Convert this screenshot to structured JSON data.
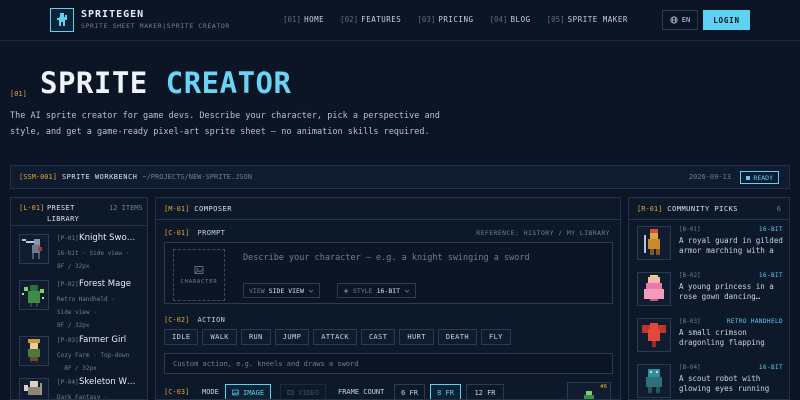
{
  "nav": {
    "brand": "SPRITEGEN",
    "subtitle": "SPRITE SHEET MAKER|SPRITE CREATOR",
    "links": [
      {
        "num": "[01]",
        "label": "HOME"
      },
      {
        "num": "[02]",
        "label": "FEATURES"
      },
      {
        "num": "[03]",
        "label": "PRICING"
      },
      {
        "num": "[04]",
        "label": "BLOG"
      },
      {
        "num": "[05]",
        "label": "SPRITE MAKER"
      }
    ],
    "lang": "EN",
    "login": "LOGIN"
  },
  "hero": {
    "tag": "[01]",
    "title_a": "SPRITE",
    "title_b": "CREATOR",
    "description": "The AI sprite creator for game devs. Describe your character, pick a perspective and style, and get a game-ready pixel-art sprite sheet — no animation skills required."
  },
  "workbench": {
    "tag": "[SSM-001]",
    "name": "SPRITE WORKBENCH",
    "path": "~/PROJECTS/NEW-SPRITE.JSON",
    "date": "2026-09-13",
    "status": "READY"
  },
  "library": {
    "tag": "[L-01]",
    "title": "PRESET LIBRARY",
    "count": "12 ITEMS",
    "items": [
      {
        "code": "[P-01]",
        "name": "Knight Swo…",
        "meta1": "16-bit · Side view ·",
        "meta2": "8F / 32px"
      },
      {
        "code": "[P-02]",
        "name": "Forest Mage",
        "meta1": "Retro Handheld ·",
        "meta2": "Side view ·",
        "meta3": "8F / 32px"
      },
      {
        "code": "[P-03]",
        "name": "Farmer Girl",
        "meta1": "Cozy Farm · Top-down",
        "meta2": "· 8F / 32px"
      },
      {
        "code": "[P-04]",
        "name": "Skeleton W…",
        "meta1": "Dark Fantasy ·"
      }
    ]
  },
  "composer": {
    "tag": "[M-01]",
    "title": "COMPOSER",
    "prompt_tag": "[C-01]",
    "prompt_title": "PROMPT",
    "reference": "REFERENCE: HISTORY / MY LIBRARY",
    "character_label": "CHARACTER",
    "prompt_placeholder": "Describe your character — e.g. a knight swinging a sword",
    "view_key": "VIEW",
    "view_value": "SIDE VIEW",
    "style_key": "STYLE",
    "style_value": "16-BIT",
    "action_tag": "[C-02]",
    "action_title": "ACTION",
    "actions": [
      "IDLE",
      "WALK",
      "RUN",
      "JUMP",
      "ATTACK",
      "CAST",
      "HURT",
      "DEATH",
      "FLY"
    ],
    "custom_placeholder": "Custom action, e.g. kneels and draws a sword",
    "mode_tag": "[C-03]",
    "mode_label": "MODE",
    "mode_image": "IMAGE",
    "mode_video": "VIDEO",
    "frame_label": "FRAME COUNT",
    "frames": [
      "6 FR",
      "8 FR",
      "12 FR"
    ],
    "preview_badge": "#8"
  },
  "community": {
    "tag": "[R-01]",
    "title": "COMMUNITY PICKS",
    "count": "6",
    "items": [
      {
        "code": "[B-01]",
        "tag": "16-BIT",
        "desc": "A royal guard in gilded armor marching with a"
      },
      {
        "code": "[B-02]",
        "tag": "16-BIT",
        "desc": "A young princess in a rose gown dancing…"
      },
      {
        "code": "[B-03]",
        "tag": "RETRO HANDHELD",
        "desc": "A small crimson dragonling flapping its…"
      },
      {
        "code": "[B-04]",
        "tag": "16-BIT",
        "desc": "A scout robot with glowing eyes running on…"
      }
    ]
  },
  "colors": {
    "background": "#0b1526",
    "accent_cyan": "#5fd1f2",
    "accent_amber": "#e0a43c"
  }
}
